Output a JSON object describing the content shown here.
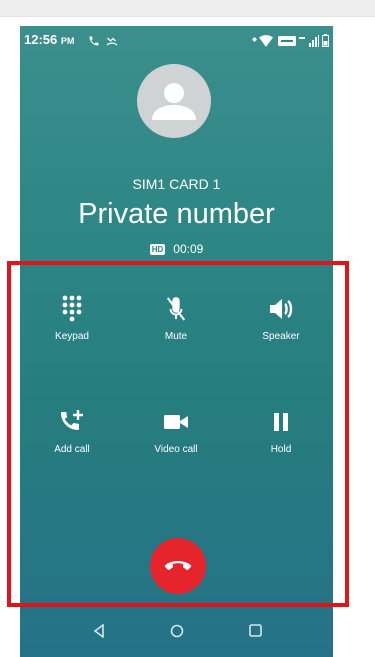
{
  "status_bar": {
    "time": "12:56",
    "ampm": "PM",
    "icons": [
      "call-icon",
      "missed-icon",
      "wifi-icon",
      "volte-icon",
      "signal-icon",
      "battery-icon"
    ]
  },
  "caller": {
    "sim_label": "SIM1 CARD 1",
    "name": "Private number",
    "hd_badge": "HD",
    "duration": "00:09"
  },
  "controls": [
    {
      "label": "Keypad",
      "icon": "keypad-icon"
    },
    {
      "label": "Mute",
      "icon": "mute-icon"
    },
    {
      "label": "Speaker",
      "icon": "speaker-icon"
    },
    {
      "label": "Add call",
      "icon": "add-call-icon"
    },
    {
      "label": "Video call",
      "icon": "video-call-icon"
    },
    {
      "label": "Hold",
      "icon": "pause-icon"
    }
  ],
  "end_call": {
    "icon": "end-call-icon"
  },
  "nav": [
    "back-icon",
    "home-icon",
    "recents-icon"
  ],
  "colors": {
    "end_call": "#e5252b",
    "highlight": "#e1141b",
    "background": "#2c8684"
  }
}
